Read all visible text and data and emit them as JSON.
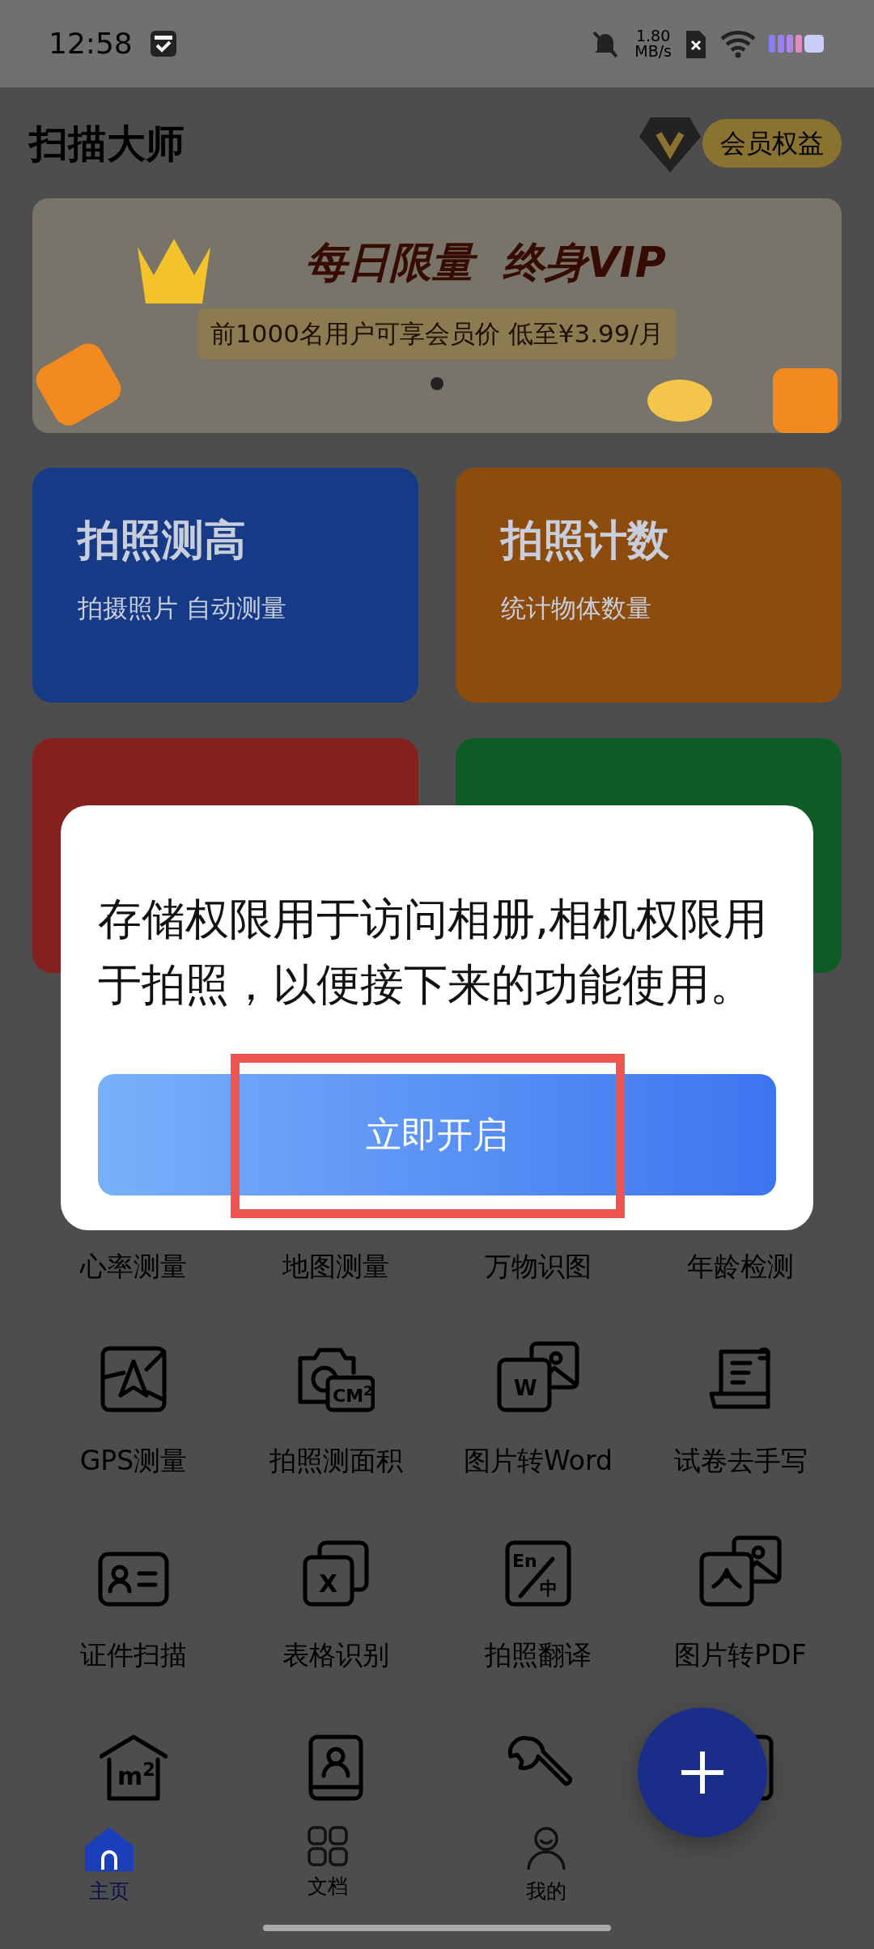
{
  "status_bar": {
    "time": "12:58",
    "net_speed_value": "1.80",
    "net_speed_unit": "MB/s"
  },
  "app_bar": {
    "title": "扫描大师",
    "vip_button": "会员权益"
  },
  "banner": {
    "headline": "每日限量  终身VIP",
    "subline": "前1000名用户可享会员价 低至¥3.99/月",
    "pages": [
      {
        "selected": true
      }
    ]
  },
  "feature_cards": [
    {
      "title": "拍照测高",
      "subtitle": "拍摄照片 自动测量",
      "color": "#163a86"
    },
    {
      "title": "拍照计数",
      "subtitle": "统计物体数量",
      "color": "#8c4c0e"
    },
    {
      "color": "#84201e"
    },
    {
      "color": "#0d5c25"
    }
  ],
  "tools": [
    {
      "kind": "label_only",
      "label": "心率测量"
    },
    {
      "kind": "label_only",
      "label": "地图测量"
    },
    {
      "kind": "label_only",
      "label": "万物识图"
    },
    {
      "kind": "label_only",
      "label": "年龄检测"
    },
    {
      "kind": "full",
      "label": "GPS测量"
    },
    {
      "kind": "full",
      "label": "拍照测面积",
      "icon_text": "CM$^{2}$"
    },
    {
      "kind": "full",
      "label": "图片转Word",
      "icon_text": "W"
    },
    {
      "kind": "full",
      "label": "试卷去手写"
    },
    {
      "kind": "full",
      "label": "证件扫描"
    },
    {
      "kind": "full",
      "label": "表格识别",
      "icon_text": "X"
    },
    {
      "kind": "full",
      "label": "拍照翻译",
      "icon_text": "En",
      "icon_text_2": "中"
    },
    {
      "kind": "full",
      "label": "图片转PDF"
    },
    {
      "kind": "icon_only",
      "icon_text": "m$^{2}$"
    },
    {
      "kind": "icon_only"
    },
    {
      "kind": "icon_only"
    },
    {
      "kind": "icon_only"
    }
  ],
  "bottom_nav": [
    {
      "label": "主页",
      "selected": true
    },
    {
      "label": "文档",
      "selected": false
    },
    {
      "label": "我的",
      "selected": false
    }
  ],
  "dialog": {
    "message": "存储权限用于访问相册,相机权限用于拍照，以便接下来的功能使用。",
    "button": "立即开启"
  }
}
